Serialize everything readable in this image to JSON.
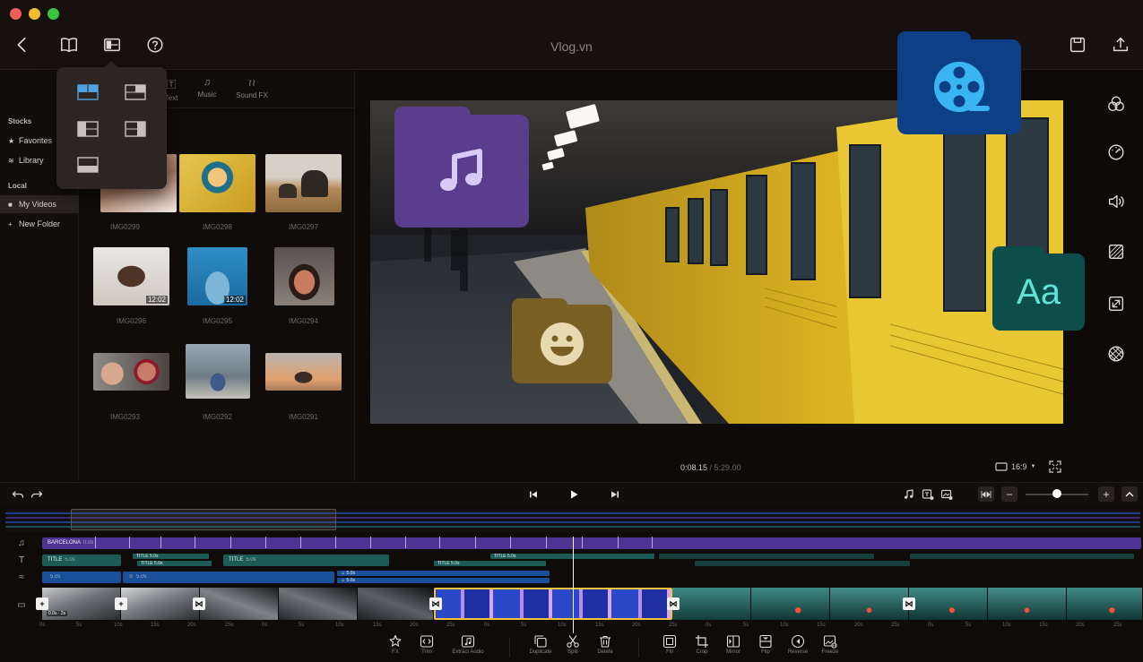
{
  "window": {
    "title": "Vlog.vn",
    "back_icon": "back-icon",
    "library_icon": "book-icon",
    "layout_icon": "layout-icon",
    "help_icon": "help-icon",
    "save_icon": "save-icon",
    "export_icon": "export-icon"
  },
  "layout_popover": {
    "options": [
      "layout-top-left",
      "layout-top-right",
      "layout-left",
      "layout-right",
      "layout-bottom"
    ],
    "selected": "layout-top-left"
  },
  "sidebar": {
    "section_stocks": "Stocks",
    "favorites": "Favorites",
    "library": "Library",
    "section_local": "Local",
    "my_videos": "My Videos",
    "new_folder": "New Folder"
  },
  "media_tabs": [
    {
      "label": "Text",
      "icon": "text-icon"
    },
    {
      "label": "Music",
      "icon": "music-icon"
    },
    {
      "label": "Sound FX",
      "icon": "sound-fx-icon"
    }
  ],
  "media": [
    {
      "name": "IMG0299",
      "duration": ""
    },
    {
      "name": "IMG0298",
      "duration": ""
    },
    {
      "name": "IMG0297",
      "duration": ""
    },
    {
      "name": "IMG0296",
      "duration": "12:02"
    },
    {
      "name": "IMG0295",
      "duration": "12:02"
    },
    {
      "name": "IMG0294",
      "duration": ""
    },
    {
      "name": "IMG0293",
      "duration": ""
    },
    {
      "name": "IMG0292",
      "duration": ""
    },
    {
      "name": "IMG0291",
      "duration": ""
    }
  ],
  "preview": {
    "current_time": "0:08.15",
    "total_time": "/ 5:29.00",
    "aspect_ratio": "16:9",
    "overlays": [
      {
        "name": "music-folder",
        "icon": "music-note-icon",
        "color": "#5a3d8c"
      },
      {
        "name": "media-folder",
        "icon": "film-reel-icon",
        "color": "#0d3f86"
      },
      {
        "name": "sticker-folder",
        "icon": "smiley-icon",
        "color": "#7a5f24"
      },
      {
        "name": "text-tile",
        "label": "Aa",
        "color": "#0d4d4a"
      }
    ]
  },
  "right_rail": [
    "color-filter-icon",
    "speed-icon",
    "volume-icon",
    "adjust-icon",
    "resize-icon",
    "texture-icon"
  ],
  "transport": {
    "undo_icon": "undo-icon",
    "redo_icon": "redo-icon",
    "prev_icon": "skip-back-icon",
    "play_icon": "play-icon",
    "next_icon": "skip-forward-icon",
    "zoom_out": "−",
    "zoom_in": "+",
    "zoom_level": 0.5
  },
  "timeline": {
    "music_clip": {
      "label": "BARCELONA",
      "meta": "0.0s"
    },
    "text_clips": [
      {
        "label": "TITLE",
        "meta": "5.0s"
      },
      {
        "label": "TITLE",
        "meta": "5.0s"
      },
      {
        "label": "TITLE",
        "meta": "5.0s"
      },
      {
        "label": "TITLE",
        "meta": "5.0s"
      },
      {
        "label": "TITLE",
        "meta": "5.0s"
      },
      {
        "label": "TITLE",
        "meta": "5.0s"
      }
    ],
    "sticker_clips": [
      {
        "meta": "5.0s"
      },
      {
        "meta": "5.0s"
      },
      {
        "meta": "5.0s"
      },
      {
        "meta": "5.0s"
      }
    ],
    "first_clip_meta": "0.0s · 2s",
    "ruler": [
      "0s",
      "5s",
      "10s",
      "15s",
      "20s",
      "25s",
      "0s",
      "5s",
      "10s",
      "15s",
      "20s",
      "25s",
      "0s",
      "5s",
      "10s",
      "15s",
      "20s",
      "25s",
      "0s",
      "5s",
      "10s",
      "15s",
      "20s",
      "25s",
      "0s",
      "5s",
      "10s",
      "15s",
      "20s",
      "25s"
    ]
  },
  "toolbar": [
    {
      "label": "FX",
      "icon": "fx-icon"
    },
    {
      "label": "Trim",
      "icon": "trim-icon"
    },
    {
      "label": "Extract Audio",
      "icon": "extract-audio-icon"
    },
    {
      "label": "Duplicate",
      "icon": "duplicate-icon"
    },
    {
      "label": "Split",
      "icon": "split-icon"
    },
    {
      "label": "Delete",
      "icon": "delete-icon"
    },
    {
      "label": "Fill",
      "icon": "fill-icon"
    },
    {
      "label": "Crop",
      "icon": "crop-icon"
    },
    {
      "label": "Mirror",
      "icon": "mirror-icon"
    },
    {
      "label": "Flip",
      "icon": "flip-icon"
    },
    {
      "label": "Reverse",
      "icon": "reverse-icon"
    },
    {
      "label": "Freeze",
      "icon": "freeze-icon"
    }
  ]
}
